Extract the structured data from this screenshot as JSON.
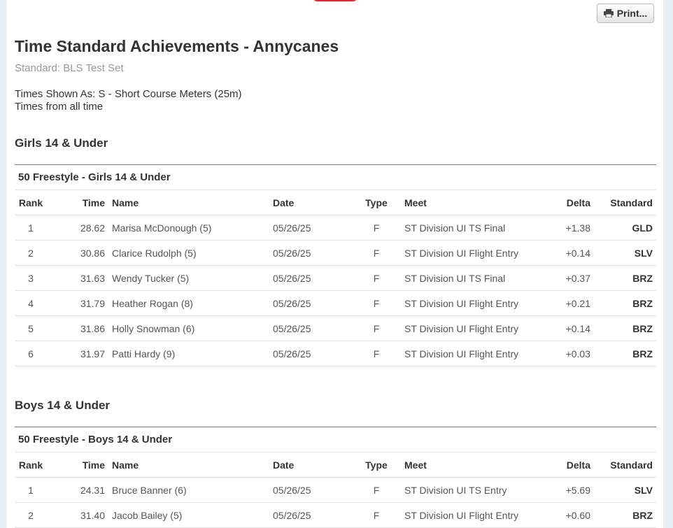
{
  "page": {
    "title": "Time Standard Achievements - Annycanes",
    "standard": "Standard: BLS Test Set",
    "times_shown": "Times Shown As: S - Short Course Meters (25m)",
    "times_from": "Times from all time",
    "print_label": "Print..."
  },
  "columns": {
    "rank": "Rank",
    "time": "Time",
    "name": "Name",
    "date": "Date",
    "type": "Type",
    "meet": "Meet",
    "delta": "Delta",
    "standard": "Standard"
  },
  "groups": [
    {
      "title": "Girls 14 & Under",
      "event": "50 Freestyle - Girls 14 & Under",
      "rows": [
        {
          "rank": "1",
          "time": "28.62",
          "name": "Marisa McDonough (5)",
          "date": "05/26/25",
          "type": "F",
          "meet": "ST Division UI TS Final",
          "delta": "+1.38",
          "standard": "GLD"
        },
        {
          "rank": "2",
          "time": "30.86",
          "name": "Clarice Rudolph (5)",
          "date": "05/26/25",
          "type": "F",
          "meet": "ST Division UI Flight Entry",
          "delta": "+0.14",
          "standard": "SLV"
        },
        {
          "rank": "3",
          "time": "31.63",
          "name": "Wendy Tucker (5)",
          "date": "05/26/25",
          "type": "F",
          "meet": "ST Division UI TS Final",
          "delta": "+0.37",
          "standard": "BRZ"
        },
        {
          "rank": "4",
          "time": "31.79",
          "name": "Heather Rogan (8)",
          "date": "05/26/25",
          "type": "F",
          "meet": "ST Division UI Flight Entry",
          "delta": "+0.21",
          "standard": "BRZ"
        },
        {
          "rank": "5",
          "time": "31.86",
          "name": "Holly Snowman (6)",
          "date": "05/26/25",
          "type": "F",
          "meet": "ST Division UI Flight Entry",
          "delta": "+0.14",
          "standard": "BRZ"
        },
        {
          "rank": "6",
          "time": "31.97",
          "name": "Patti Hardy (9)",
          "date": "05/26/25",
          "type": "F",
          "meet": "ST Division UI Flight Entry",
          "delta": "+0.03",
          "standard": "BRZ"
        }
      ]
    },
    {
      "title": "Boys 14 & Under",
      "event": "50 Freestyle - Boys 14 & Under",
      "rows": [
        {
          "rank": "1",
          "time": "24.31",
          "name": "Bruce Banner (6)",
          "date": "05/26/25",
          "type": "F",
          "meet": "ST Division UI TS Entry",
          "delta": "+5.69",
          "standard": "SLV"
        },
        {
          "rank": "2",
          "time": "31.40",
          "name": "Jacob Bailey (5)",
          "date": "05/26/25",
          "type": "F",
          "meet": "ST Division UI Flight Entry",
          "delta": "+0.60",
          "standard": "BRZ"
        }
      ]
    }
  ],
  "icons": {
    "print": "printer-icon"
  },
  "colors": {
    "accent": "#e0282e",
    "muted": "#999999",
    "rule": "#777777"
  }
}
